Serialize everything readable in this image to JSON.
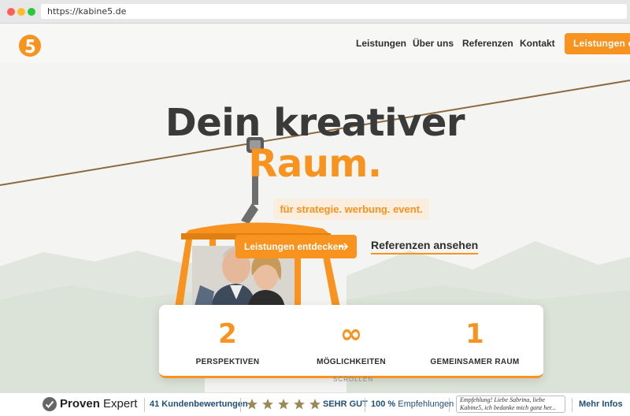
{
  "browser": {
    "url": "https://kabine5.de"
  },
  "header": {
    "logo_icon": "kabine5-logo-icon",
    "nav": [
      "Leistungen",
      "Über uns",
      "Referenzen",
      "Kontakt"
    ],
    "cta_label": "Leistungen entdecken"
  },
  "hero": {
    "headline_line1": "Dein kreativer",
    "headline_line2": "Raum.",
    "tagline": "für strategie. werbung. event.",
    "primary_button": "Leistungen entdecken",
    "primary_button_icon": "arrow-right-icon",
    "secondary_link": "Referenzen ansehen",
    "image_icon": "gondola-photo-icon"
  },
  "stats": [
    {
      "value": "2",
      "label": "PERSPEKTIVEN"
    },
    {
      "value": "∞",
      "label": "MÖGLICHKEITEN"
    },
    {
      "value": "1",
      "label": "GEMEINSAMER RAUM"
    }
  ],
  "scroll_hint": "SCROLLEN",
  "proven_expert": {
    "brand_bold": "Proven",
    "brand_regular": " Expert",
    "reviews": "41 Kundenbewertungen",
    "stars": 5,
    "rating_text": "SEHR GUT",
    "recommendation_pct": "100 %",
    "recommendation_label": " Empfehlungen",
    "quote": "Empfehlung! Liebe Sabrina, liebe Kabine5, ich bedanke mich ganz her...",
    "more_info": "Mehr Infos"
  },
  "colors": {
    "accent": "#f7931e",
    "text_dark": "#3a3a3a",
    "pe_blue": "#1f4e79"
  }
}
